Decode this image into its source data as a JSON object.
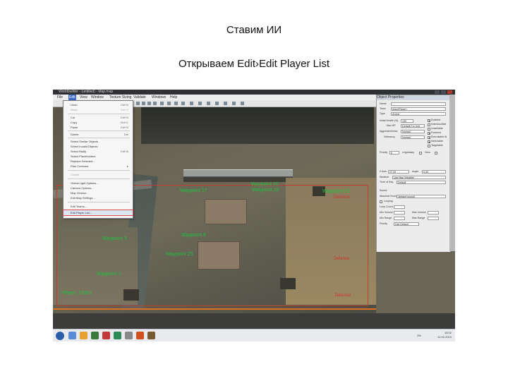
{
  "slide": {
    "title": "Ставим ИИ",
    "subtitle": "Открываем Edit›Edit Player List"
  },
  "window": {
    "title": "Worldbuilder - (untitled) - Map.map"
  },
  "menubar": {
    "items": [
      {
        "label": "File"
      },
      {
        "label": "Edit"
      },
      {
        "label": "View"
      },
      {
        "label": "Window"
      },
      {
        "label": "Texture Sizing"
      },
      {
        "label": "Validate"
      },
      {
        "label": "Windows"
      },
      {
        "label": "Help"
      }
    ]
  },
  "edit_menu": {
    "items": [
      {
        "label": "Undo",
        "shortcut": "Ctrl+Z"
      },
      {
        "label": "Redo",
        "shortcut": "Ctrl+Y"
      },
      {
        "label": "Cut",
        "shortcut": "Ctrl+X"
      },
      {
        "label": "Copy",
        "shortcut": "Ctrl+C"
      },
      {
        "label": "Paste",
        "shortcut": "Ctrl+V"
      },
      {
        "label": "Delete",
        "shortcut": "Del"
      },
      {
        "label": "Select Similar Objects",
        "shortcut": ""
      },
      {
        "label": "Select Invalid Objects",
        "shortcut": ""
      },
      {
        "label": "Select Badly",
        "shortcut": "Ctrl+A"
      },
      {
        "label": "Select Placeholders",
        "shortcut": ""
      },
      {
        "label": "Replace Selected...",
        "shortcut": ""
      },
      {
        "label": "Plan Contours",
        "shortcut": ""
      },
      {
        "label": "Create",
        "shortcut": ""
      },
      {
        "label": "Global Light Options...",
        "shortcut": ""
      },
      {
        "label": "Camera Options...",
        "shortcut": ""
      },
      {
        "label": "Map Version...",
        "shortcut": ""
      },
      {
        "label": "Edit Map Settings...",
        "shortcut": ""
      },
      {
        "label": "Edit Teams...",
        "shortcut": ""
      },
      {
        "label": "Edit Player List...",
        "shortcut": ""
      }
    ]
  },
  "viewport": {
    "waypoints": [
      {
        "label": "Waypoint 20"
      },
      {
        "label": "Waypoint 17"
      },
      {
        "label": "Waypoint 16"
      },
      {
        "label": "Waypoint 22"
      },
      {
        "label": "Waypoint 8"
      },
      {
        "label": "Waypoint 25"
      },
      {
        "label": "Waypoint 3"
      },
      {
        "label": "Waypoint 1"
      },
      {
        "label": "Player_1Start"
      }
    ],
    "red_labels": [
      {
        "label": "Defense"
      },
      {
        "label": "Defense"
      },
      {
        "label": "Defense"
      }
    ]
  },
  "properties_panel": {
    "title": "Object Properties",
    "name_label": "Name",
    "name_value": "",
    "team_label": "Team",
    "team_value": "team(Player)",
    "type_label": "Type",
    "type_value": "Archer",
    "health_label": "Initial Health (%)",
    "health_value": "100",
    "max_hp_label": "Max HP",
    "max_hp_value": "Default For Unit",
    "aggressiveness_label": "Aggressiveness",
    "aggressiveness_value": "Normal",
    "veterancy_label": "Veterancy",
    "veterancy_value": "Normal",
    "checkboxes": [
      {
        "label": "Enabled",
        "checked": true
      },
      {
        "label": "Indestructible",
        "checked": false
      },
      {
        "label": "Unsellable",
        "checked": false
      },
      {
        "label": "Powered",
        "checked": true
      },
      {
        "label": "Recruitable AI",
        "checked": true
      },
      {
        "label": "Selectable",
        "checked": true
      },
      {
        "label": "Targetable",
        "checked": false
      }
    ],
    "priority_label": "Priority",
    "priority_value": "5",
    "legendary_label": "Legendary",
    "hero_label": "Hero",
    "z_label": "Z Axis",
    "z_value": "27.33",
    "angle_label": "Angle",
    "angle_value": "0.00",
    "weather_label": "Weather",
    "weather_value": "Use Map Weather",
    "time_label": "Time of Day",
    "time_value": "Default",
    "sound_label": "Sound",
    "attached_sound_label": "Attached Sound",
    "attached_sound_value": "(default sound)",
    "looping_label": "Looping",
    "loop_count_label": "Loop Count",
    "min_volume_label": "Min Volume",
    "max_volume_label": "Max Volume",
    "min_range_label": "Min Range",
    "max_range_label": "Max Range",
    "priority2_label": "Priority",
    "priority2_value": "Use Default"
  },
  "taskbar": {
    "lang": "EN",
    "time": "15:02",
    "date": "12.02.2010"
  },
  "colors": {
    "waypoint_green": "#20c040",
    "defense_red": "#d03030",
    "menu_highlight": "#dbe6f7",
    "highlight_outline": "#e04848"
  }
}
